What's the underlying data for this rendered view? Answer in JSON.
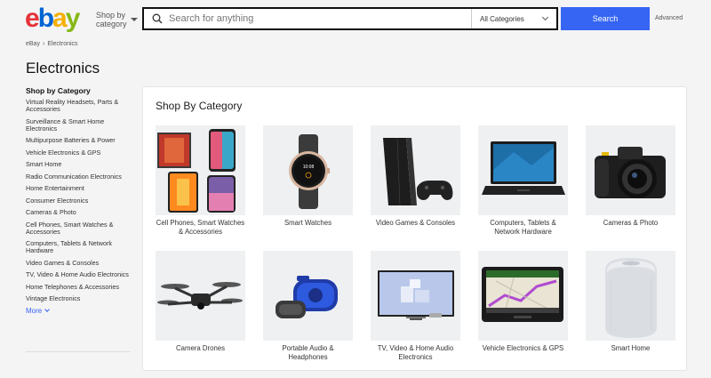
{
  "header": {
    "logo": {
      "e": "e",
      "b": "b",
      "a": "a",
      "y": "y",
      "colors": [
        "#e53238",
        "#0064d2",
        "#f5af02",
        "#86b817"
      ]
    },
    "shop_by": {
      "line1": "Shop by",
      "line2": "category"
    },
    "search": {
      "placeholder": "Search for anything",
      "category_value": "All Categories",
      "button": "Search"
    },
    "advanced": "Advanced"
  },
  "breadcrumb": {
    "home": "eBay",
    "separator": "›",
    "current": "Electronics"
  },
  "page_title": "Electronics",
  "sidebar": {
    "heading": "Shop by Category",
    "items": [
      "Virtual Reality Headsets, Parts & Accessories",
      "Surveillance & Smart Home Electronics",
      "Multipurpose Batteries & Power",
      "Vehicle Electronics & GPS",
      "Smart Home",
      "Radio Communication Electronics",
      "Home Entertainment",
      "Consumer Electronics",
      "Cameras & Photo",
      "Cell Phones, Smart Watches & Accessories",
      "Computers, Tablets & Network Hardware",
      "Video Games & Consoles",
      "TV, Video & Home Audio Electronics",
      "Home Telephones & Accessories",
      "Vintage Electronics"
    ],
    "more": "More"
  },
  "panel": {
    "title": "Shop By Category",
    "tiles": [
      {
        "label": "Cell Phones, Smart Watches & Accessories",
        "icon": "phones-image"
      },
      {
        "label": "Smart Watches",
        "icon": "smartwatch-image"
      },
      {
        "label": "Video Games & Consoles",
        "icon": "console-image"
      },
      {
        "label": "Computers, Tablets & Network Hardware",
        "icon": "laptop-image"
      },
      {
        "label": "Cameras & Photo",
        "icon": "camera-image"
      },
      {
        "label": "Camera Drones",
        "icon": "drone-image"
      },
      {
        "label": "Portable Audio & Headphones",
        "icon": "speaker-image"
      },
      {
        "label": "TV, Video & Home Audio Electronics",
        "icon": "tv-image"
      },
      {
        "label": "Vehicle Electronics & GPS",
        "icon": "gps-image"
      },
      {
        "label": "Smart Home",
        "icon": "smart-speaker-image"
      }
    ]
  },
  "accent_colors": {
    "primary_blue": "#3665f3",
    "background": "#f4f4f4"
  }
}
